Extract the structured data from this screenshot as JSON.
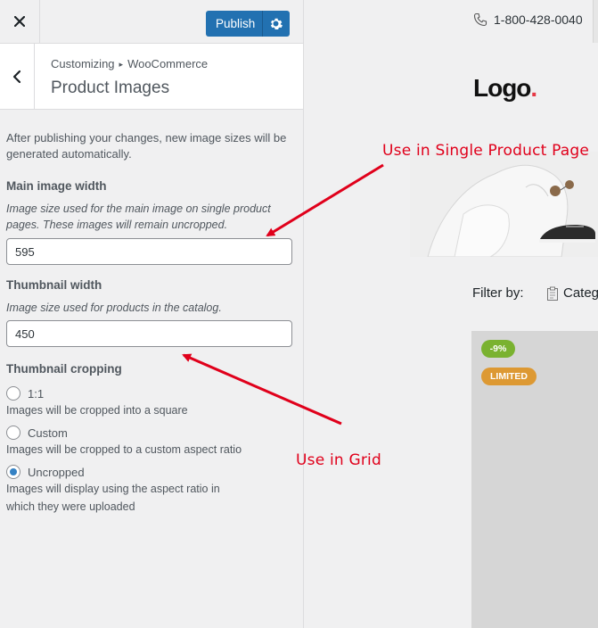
{
  "topbar": {
    "publish_label": "Publish"
  },
  "section": {
    "breadcrumb_parent": "Customizing",
    "breadcrumb_child": "WooCommerce",
    "title": "Product Images"
  },
  "intro": "After publishing your changes, new image sizes will be generated automatically.",
  "main_image": {
    "title": "Main image width",
    "description": "Image size used for the main image on single product pages. These images will remain uncropped.",
    "value": "595"
  },
  "thumbnail": {
    "title": "Thumbnail width",
    "description": "Image size used for products in the catalog.",
    "value": "450"
  },
  "cropping": {
    "title": "Thumbnail cropping",
    "options": [
      {
        "label": "1:1",
        "description": "Images will be cropped into a square",
        "checked": false
      },
      {
        "label": "Custom",
        "description": "Images will be cropped to a custom aspect ratio",
        "checked": false
      },
      {
        "label": "Uncropped",
        "description": "Images will display using the aspect ratio in which they were uploaded",
        "checked": true
      }
    ]
  },
  "preview": {
    "phone": "1-800-428-0040",
    "logo_text": "Logo",
    "logo_dot": ".",
    "filter_label": "Filter by:",
    "category_label": "Categ",
    "badges": {
      "sale": "-9%",
      "limited": "LIMITED"
    }
  },
  "annotations": {
    "single_product": "Use in Single Product Page",
    "grid": "Use in Grid"
  },
  "colors": {
    "accent": "#2271b1",
    "sale_badge": "#7ab230",
    "limited_badge": "#dd9933",
    "annotation": "#e0001b",
    "logo_dot": "#e63946"
  }
}
